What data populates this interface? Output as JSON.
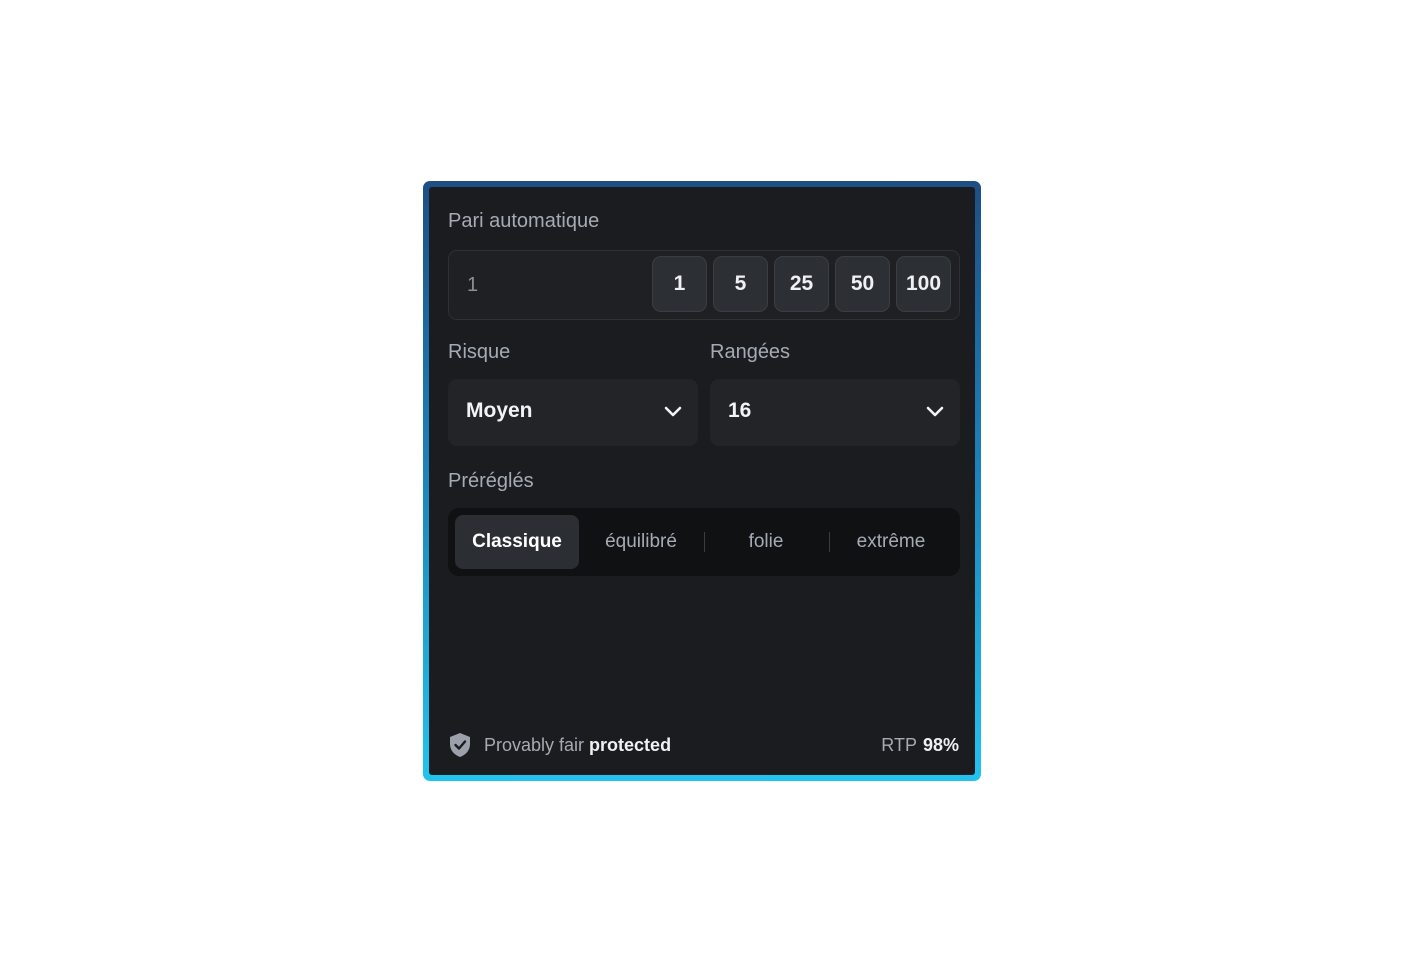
{
  "auto_bet": {
    "label": "Pari automatique",
    "amount_value": "1",
    "chips": [
      "1",
      "5",
      "25",
      "50",
      "100"
    ]
  },
  "risk": {
    "label": "Risque",
    "value": "Moyen",
    "icon": "chevron-down-icon"
  },
  "rows": {
    "label": "Rangées",
    "value": "16",
    "icon": "chevron-down-icon"
  },
  "presets": {
    "label": "Préréglés",
    "options": [
      "Classique",
      "équilibré",
      "folie",
      "extrême"
    ],
    "selected": "Classique"
  },
  "footer": {
    "fair_prefix": "Provably fair",
    "fair_strong": "protected",
    "shield_icon": "shield-check-icon",
    "rtp_label": "RTP",
    "rtp_value": "98%"
  },
  "colors": {
    "panel_bg": "#1b1c1f",
    "border_gradient_top": "#1d4f84",
    "border_gradient_bottom": "#22c3ee",
    "active_preset_bg": "#2b2e33"
  }
}
